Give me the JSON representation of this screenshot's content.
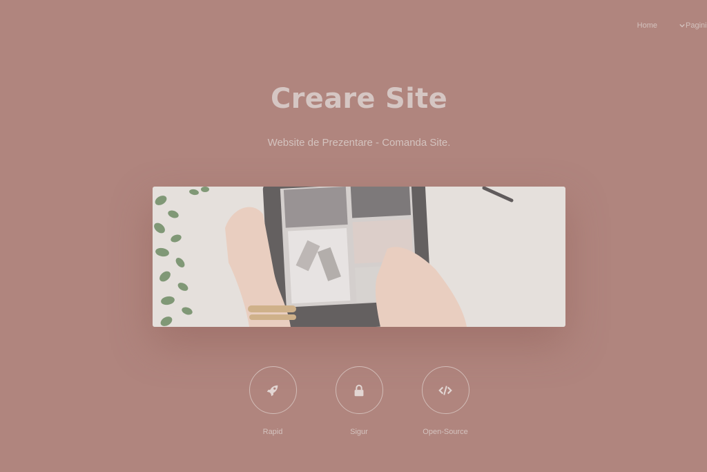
{
  "nav": {
    "home_label": "Home",
    "pages_label": "Pagini"
  },
  "hero": {
    "title": "Creare Site",
    "subtitle": "Website de Prezentare - Comanda Site."
  },
  "features": [
    {
      "label": "Rapid",
      "icon": "rocket-icon"
    },
    {
      "label": "Sigur",
      "icon": "lock-icon"
    },
    {
      "label": "Open-Source",
      "icon": "code-icon"
    }
  ],
  "colors": {
    "overlay": "#b0857e",
    "text": "#d5c6c3"
  }
}
